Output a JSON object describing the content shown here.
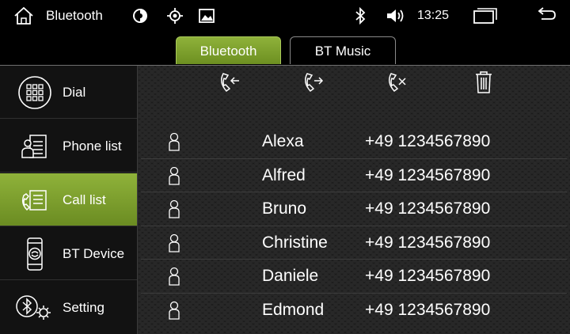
{
  "status_bar": {
    "title": "Bluetooth",
    "time": "13:25",
    "icons": [
      "home-icon",
      "brightness-icon",
      "gps-icon",
      "gallery-icon",
      "bluetooth-icon",
      "volume-icon",
      "recent-apps-icon",
      "back-icon"
    ]
  },
  "tabs": [
    {
      "label": "Bluetooth",
      "active": true
    },
    {
      "label": "BT Music",
      "active": false
    }
  ],
  "sidebar": {
    "items": [
      {
        "label": "Dial",
        "icon": "dialpad-icon",
        "active": false
      },
      {
        "label": "Phone list",
        "icon": "phonebook-icon",
        "active": false
      },
      {
        "label": "Call list",
        "icon": "call-list-icon",
        "active": true
      },
      {
        "label": "BT Device",
        "icon": "bt-device-icon",
        "active": false
      },
      {
        "label": "Setting",
        "icon": "bt-settings-icon",
        "active": false
      }
    ]
  },
  "toolbar": {
    "icons": [
      "incoming-call-icon",
      "outgoing-call-icon",
      "missed-call-icon",
      "trash-icon"
    ]
  },
  "call_list": [
    {
      "name": "Alexa",
      "number": "+49 1234567890"
    },
    {
      "name": "Alfred",
      "number": "+49 1234567890"
    },
    {
      "name": "Bruno",
      "number": "+49 1234567890"
    },
    {
      "name": "Christine",
      "number": "+49 1234567890"
    },
    {
      "name": "Daniele",
      "number": "+49 1234567890"
    },
    {
      "name": "Edmond",
      "number": "+49 1234567890"
    }
  ],
  "colors": {
    "accent": "#7fa12e",
    "background": "#1c1c1c",
    "bar": "#000000"
  }
}
